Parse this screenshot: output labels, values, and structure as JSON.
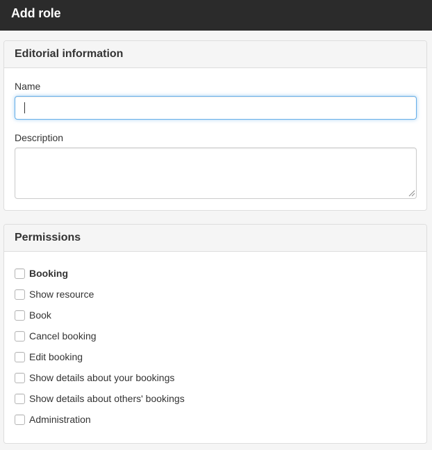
{
  "header": {
    "title": "Add role"
  },
  "editorial": {
    "heading": "Editorial information",
    "name_label": "Name",
    "name_value": "",
    "description_label": "Description",
    "description_value": ""
  },
  "permissions": {
    "heading": "Permissions",
    "items": [
      {
        "label": "Booking",
        "checked": false,
        "bold": true
      },
      {
        "label": "Show resource",
        "checked": false
      },
      {
        "label": "Book",
        "checked": false
      },
      {
        "label": "Cancel booking",
        "checked": false
      },
      {
        "label": "Edit booking",
        "checked": false
      },
      {
        "label": "Show details about your bookings",
        "checked": false
      },
      {
        "label": "Show details about others' bookings",
        "checked": false
      },
      {
        "label": "Administration",
        "checked": false
      }
    ]
  },
  "colors": {
    "header_bg": "#2b2b2b",
    "focus_border": "#66afe9",
    "panel_border": "#dddddd"
  }
}
